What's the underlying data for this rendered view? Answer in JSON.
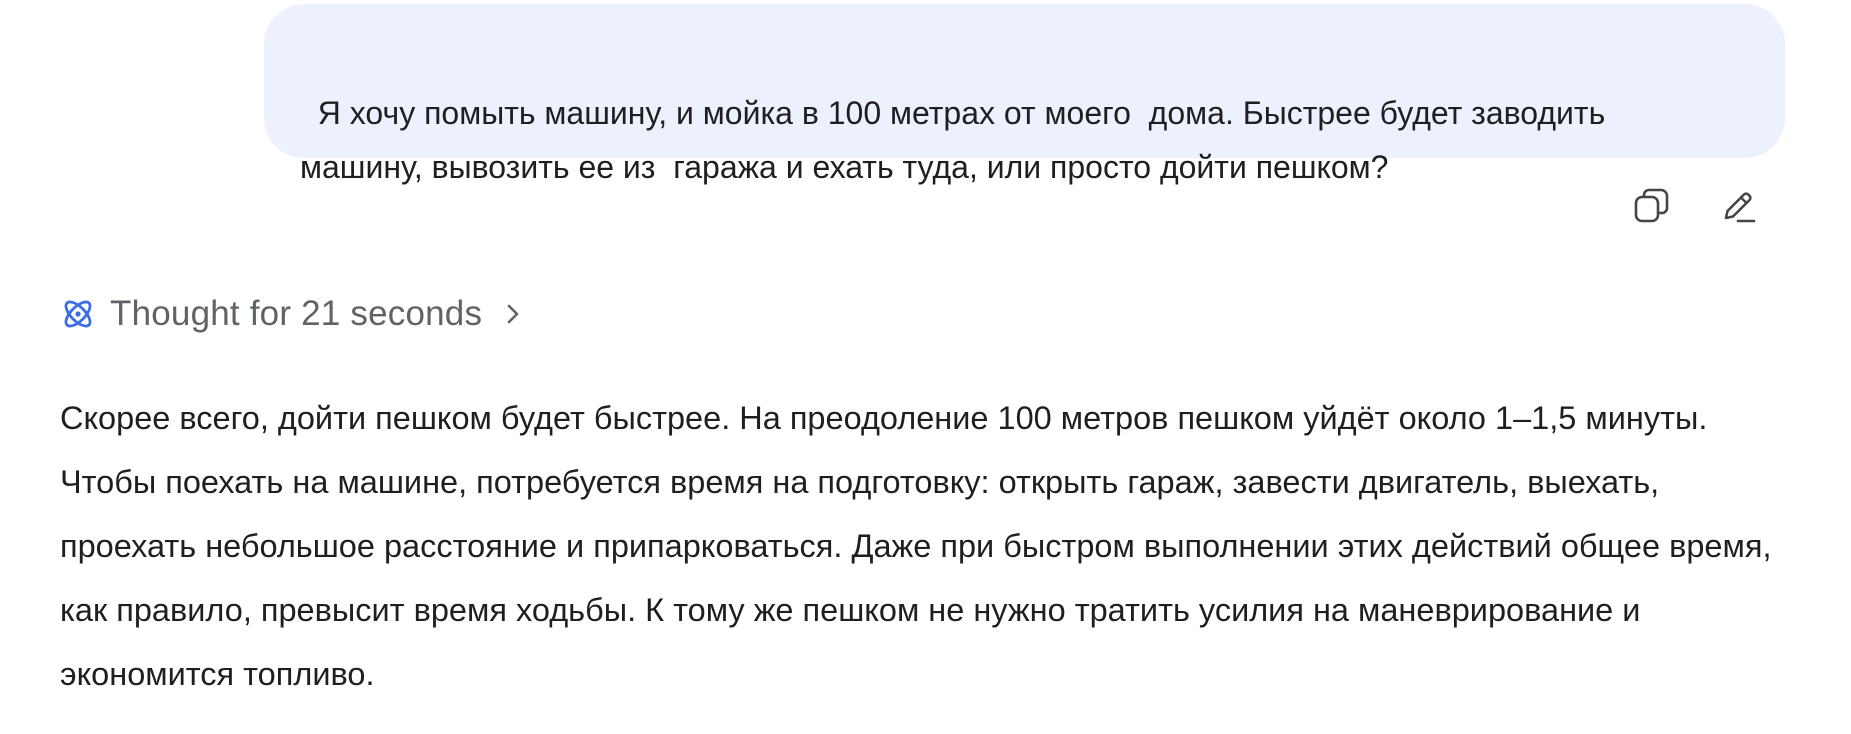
{
  "user_message": {
    "text": "Я хочу помыть машину, и мойка в 100 метрах от моего  дома. Быстрее будет заводить машину, вывозить ее из  гаража и ехать туда, или просто дойти пешком?"
  },
  "message_actions": {
    "copy_icon": "copy-icon",
    "edit_icon": "edit-pencil-icon"
  },
  "thought": {
    "label": "Thought for 21 seconds",
    "icon": "atom-icon",
    "chevron": "chevron-right-icon"
  },
  "answer": {
    "text": "Скорее всего, дойти пешком будет быстрее. На преодоление 100 метров пешком уйдёт около 1–1,5 минуты. Чтобы поехать на машине, потребуется время на подготовку: открыть гараж, завести двигатель, выехать, проехать небольшое расстояние и припарковаться. Даже при быстром выполнении этих действий общее время, как правило, превысит время ходьбы. К тому же пешком не нужно тратить усилия на маневрирование и экономится топливо."
  },
  "colors": {
    "bubble_bg": "#ecf1fd",
    "accent_blue": "#3b6de6",
    "muted_text": "#5f6368",
    "icon_gray": "#444746"
  }
}
